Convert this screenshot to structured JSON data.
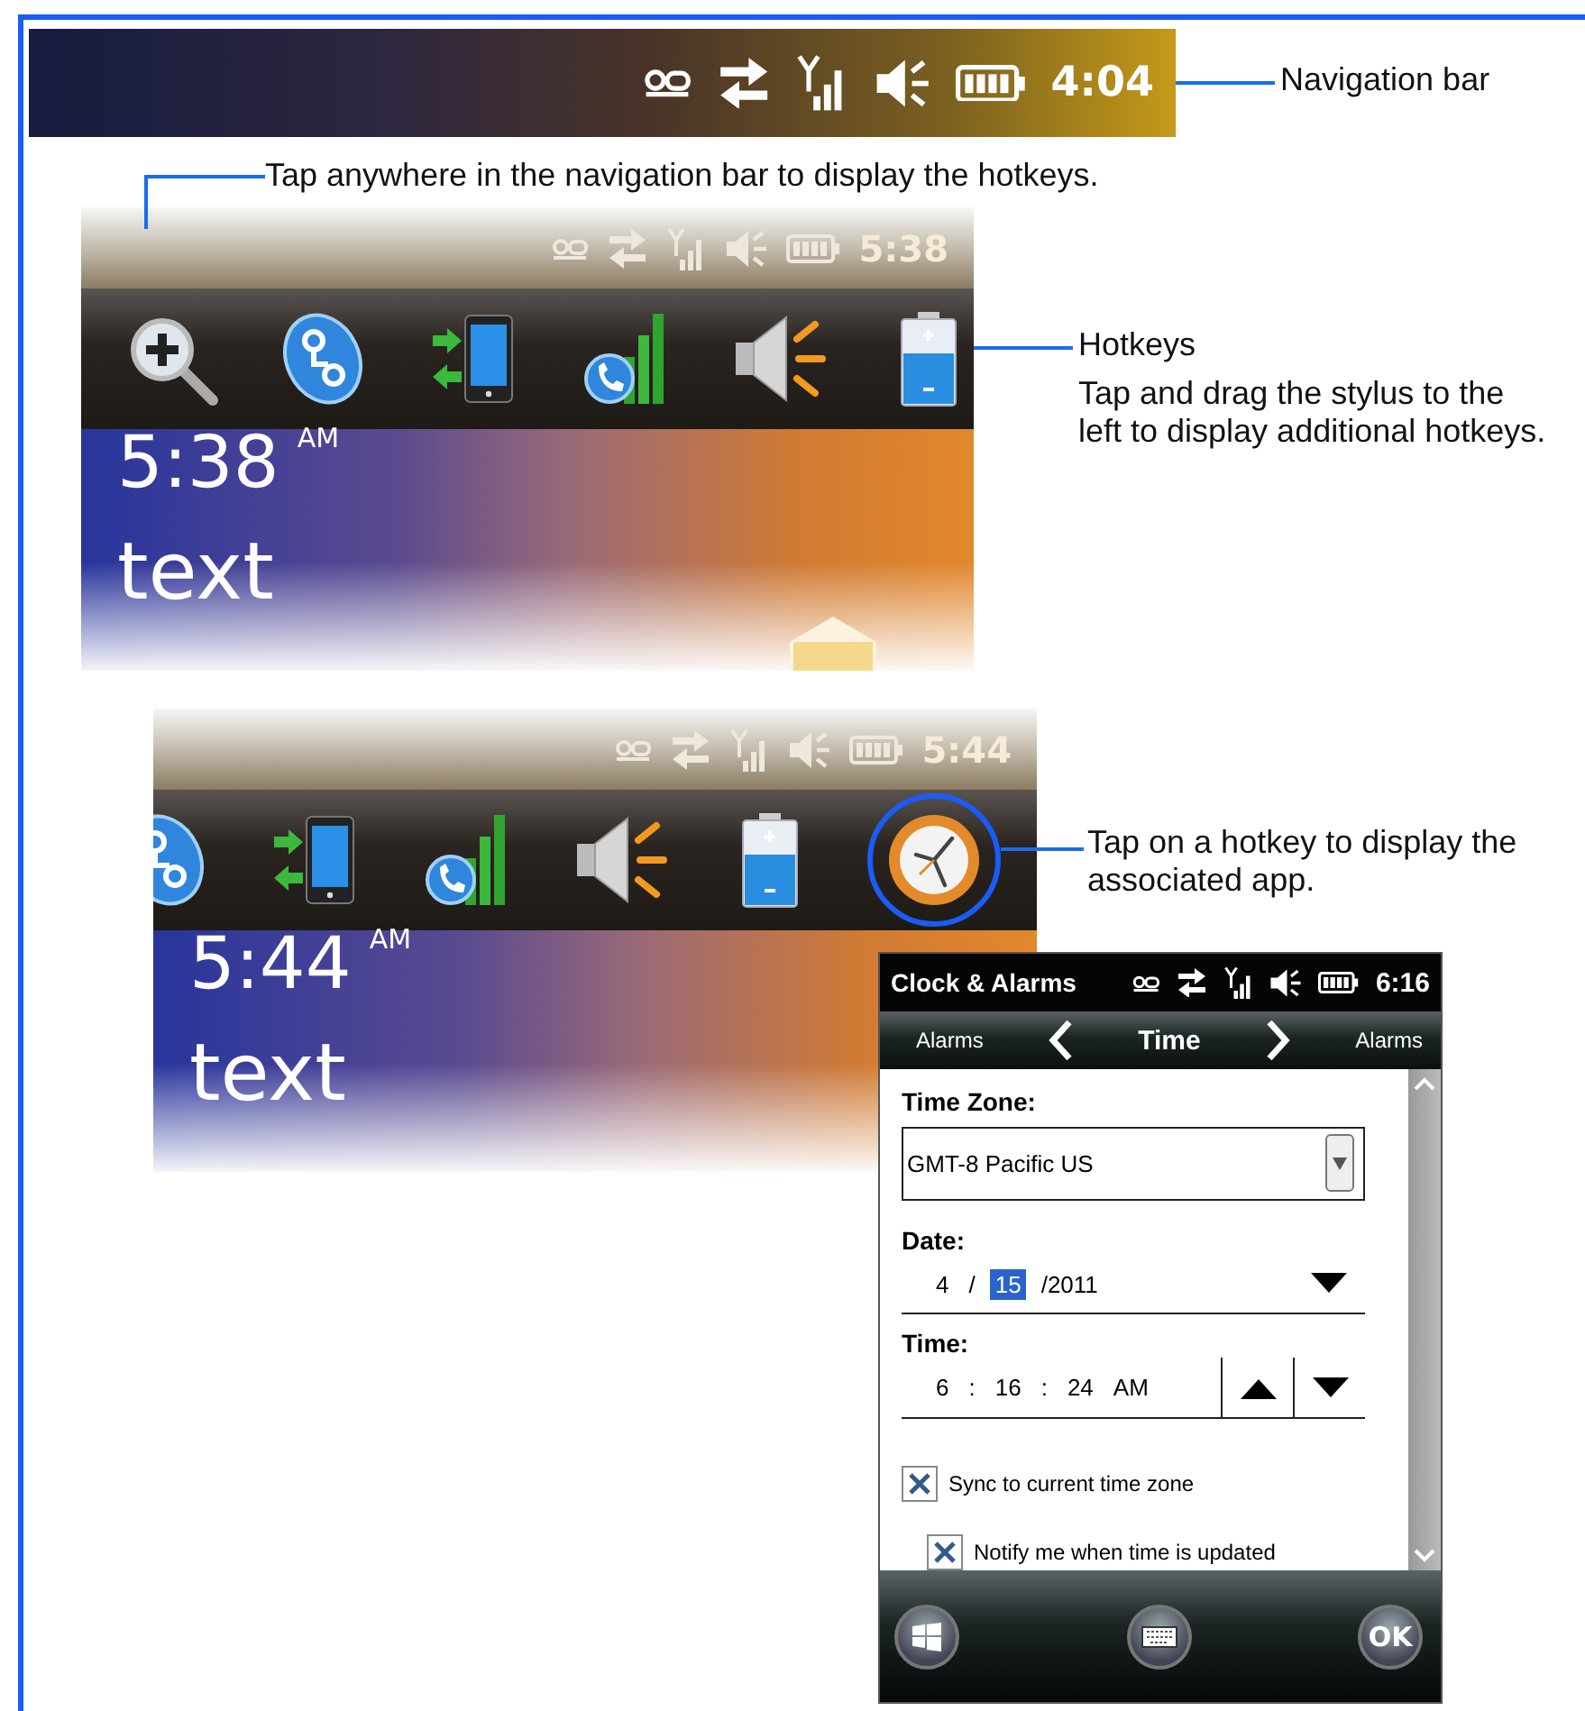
{
  "navigation_bar": {
    "time": "4:04"
  },
  "callouts": [
    {
      "text": "Navigation bar"
    },
    {
      "text": "Tap anywhere in the navigation bar to display the hotkeys."
    },
    {
      "title": "Hotkeys",
      "text": "Tap and drag the stylus to the left to display additional hotkeys."
    },
    {
      "text": "Tap on a hotkey to display the associated app."
    }
  ],
  "screens": [
    {
      "status_time": "5:38",
      "scrolled": false,
      "clock": "5:38",
      "meridiem": "AM",
      "label": "text",
      "hotkeys": [
        {
          "kind": "zoom",
          "circled": false
        },
        {
          "kind": "connect",
          "circled": false
        },
        {
          "kind": "sync",
          "circled": false
        },
        {
          "kind": "phone-signal",
          "circled": false
        },
        {
          "kind": "volume",
          "circled": false
        },
        {
          "kind": "battery",
          "circled": false
        }
      ]
    },
    {
      "status_time": "5:44",
      "scrolled": true,
      "clock": "5:44",
      "meridiem": "AM",
      "label": "text",
      "hotkeys": [
        {
          "kind": "connect",
          "circled": false
        },
        {
          "kind": "sync",
          "circled": false
        },
        {
          "kind": "phone-signal",
          "circled": false
        },
        {
          "kind": "volume",
          "circled": false
        },
        {
          "kind": "battery",
          "circled": false
        },
        {
          "kind": "clock",
          "circled": true
        }
      ]
    }
  ],
  "clock_app": {
    "title": "Clock & Alarms",
    "status_time": "6:16",
    "nav": {
      "previous": "Alarms",
      "current": "Time",
      "next": "Alarms"
    },
    "time_zone": {
      "label": "Time Zone:",
      "value": "GMT-8 Pacific US"
    },
    "date": {
      "label": "Date:",
      "segments": [
        {
          "text": "4",
          "selected": false
        },
        {
          "text": "/",
          "selected": false
        },
        {
          "text": "15",
          "selected": true
        },
        {
          "text": "/2011",
          "selected": false
        }
      ]
    },
    "time": {
      "label": "Time:",
      "segments": [
        {
          "text": "6",
          "selected": false
        },
        {
          "text": ":",
          "selected": false
        },
        {
          "text": "16",
          "selected": false
        },
        {
          "text": ":",
          "selected": false
        },
        {
          "text": "24",
          "selected": false
        },
        {
          "text": "AM",
          "selected": false
        }
      ]
    },
    "checkboxes": [
      {
        "label": "Sync to current time zone",
        "checked": true
      },
      {
        "label": "Notify me when time is updated",
        "checked": true
      }
    ],
    "ok_button": "OK"
  }
}
